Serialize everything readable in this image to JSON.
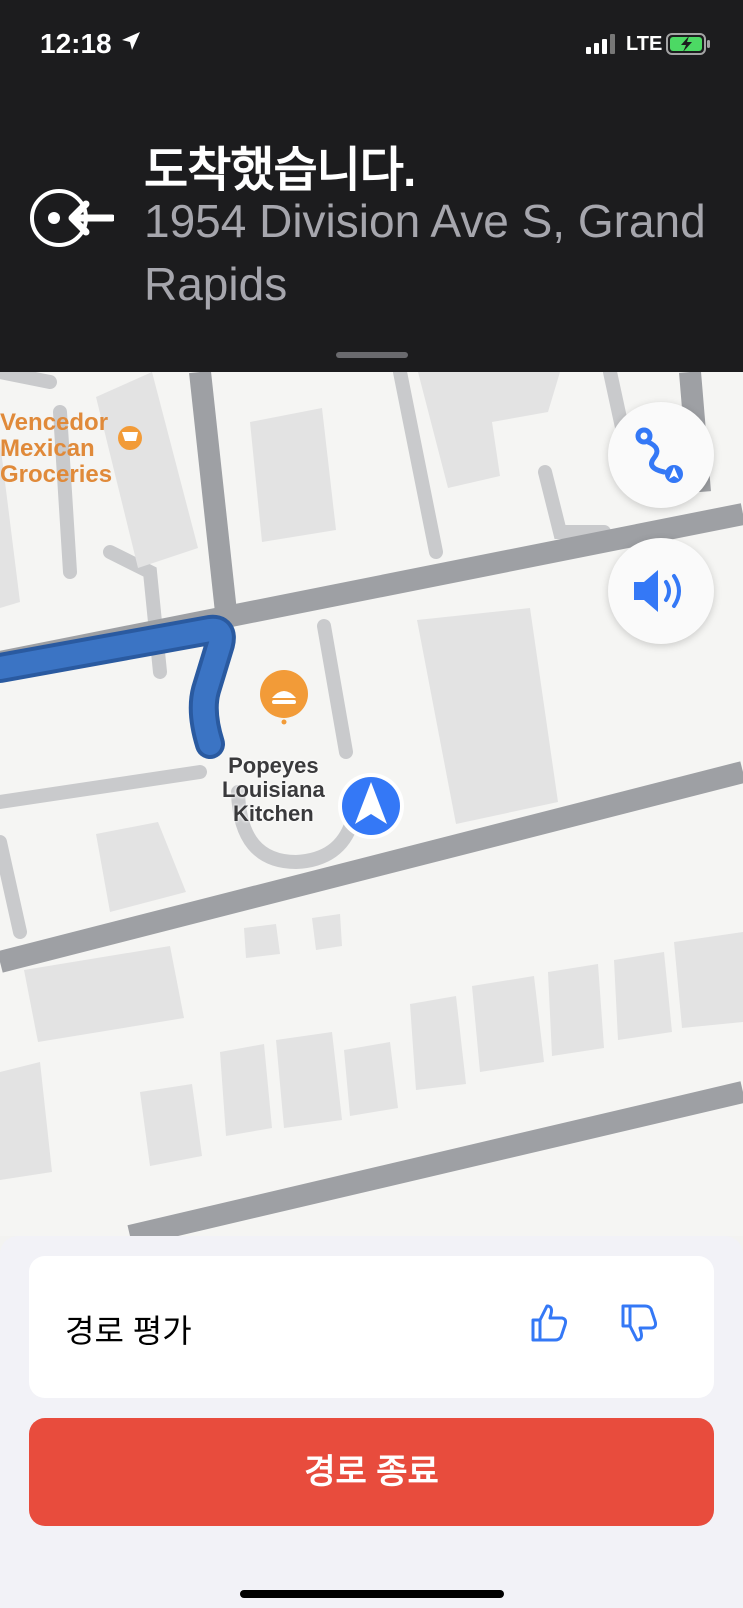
{
  "status": {
    "time": "12:18",
    "network": "LTE",
    "icons": [
      "location-arrow-icon",
      "signal-icon",
      "battery-charging-icon"
    ]
  },
  "nav": {
    "title": "도착했습니다.",
    "address": "1954 Division Ave S, Grand Rapids",
    "icon": "arrive-icon"
  },
  "map": {
    "poi_grocery": "Vencedor\nMexican\nGroceries",
    "poi_food": "Popeyes\nLouisiana\nKitchen",
    "route_color": "#3b74c4",
    "buttons": [
      "route-overview-icon",
      "speaker-icon"
    ]
  },
  "sheet": {
    "rate_label": "경로 평가",
    "thumb_up": "thumbs-up-icon",
    "thumb_down": "thumbs-down-icon",
    "end_route": "경로 종료",
    "end_color": "#e84c3d"
  }
}
